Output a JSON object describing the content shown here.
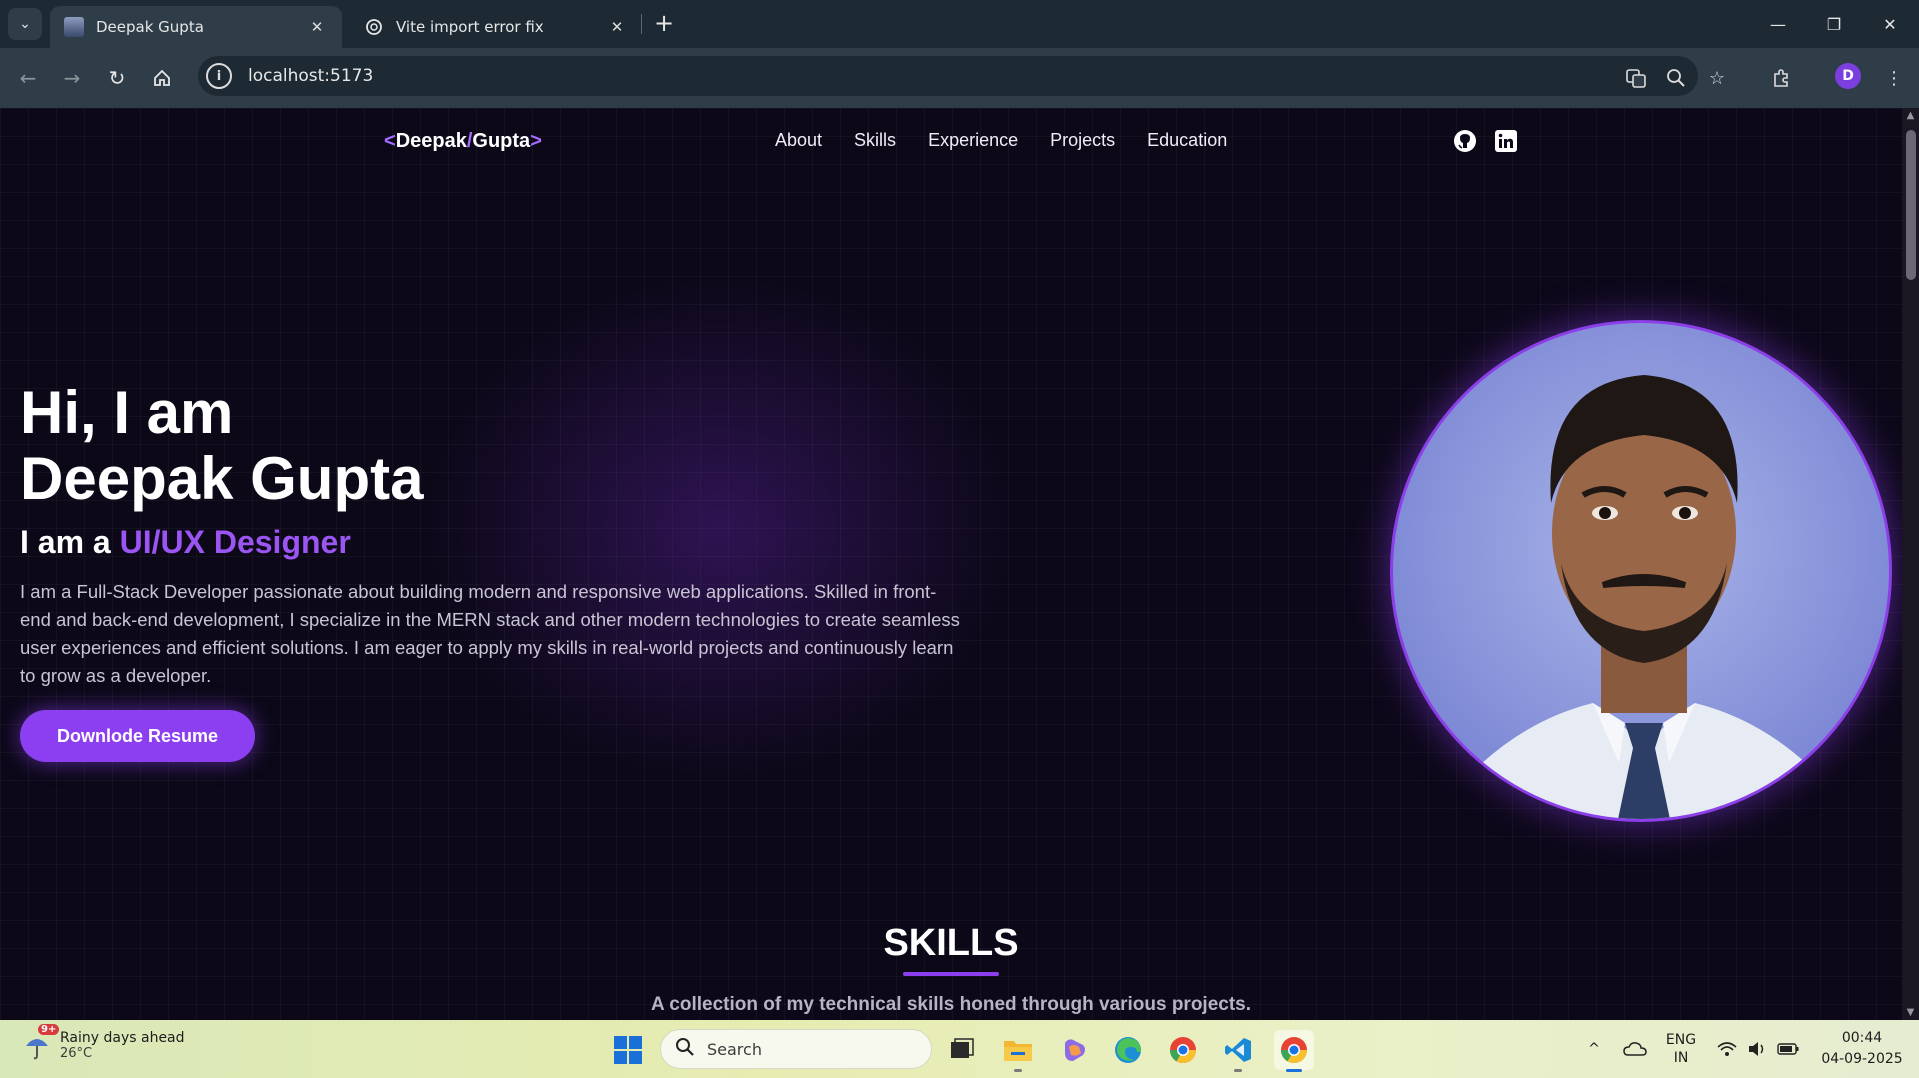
{
  "browser": {
    "tabs": [
      {
        "title": "Deepak Gupta",
        "active": true
      },
      {
        "title": "Vite import error fix",
        "active": false
      }
    ],
    "url": "localhost:5173",
    "profile_initial": "D"
  },
  "site": {
    "logo": {
      "left": "<",
      "first": "Deepak",
      "slash": "/",
      "last": "Gupta",
      "right": ">"
    },
    "nav": [
      "About",
      "Skills",
      "Experience",
      "Projects",
      "Education"
    ],
    "hero": {
      "line1": "Hi, I am",
      "line2": "Deepak Gupta",
      "role_prefix": "I am a ",
      "role_value": "UI/UX Designer",
      "bio": "I am a Full-Stack Developer passionate about building modern and responsive web applications. Skilled in front-end and back-end development, I specialize in the MERN stack and other modern technologies to create seamless user experiences and efficient solutions. I am eager to apply my skills in real-world projects and continuously learn to grow as a developer.",
      "resume_button": "Downlode Resume"
    },
    "skills": {
      "title": "SKILLS",
      "subtitle": "A collection of my technical skills honed through various projects."
    }
  },
  "taskbar": {
    "weather": {
      "badge": "9+",
      "text": "Rainy days ahead",
      "temp": "26°C"
    },
    "search_placeholder": "Search",
    "lang": {
      "line1": "ENG",
      "line2": "IN"
    },
    "time": "00:44",
    "date": "04-09-2025"
  },
  "colors": {
    "accent": "#8b3ff0",
    "accent_text": "#9b55f2",
    "page_bg": "#0c0818",
    "chrome_bg": "#2e3d47"
  }
}
